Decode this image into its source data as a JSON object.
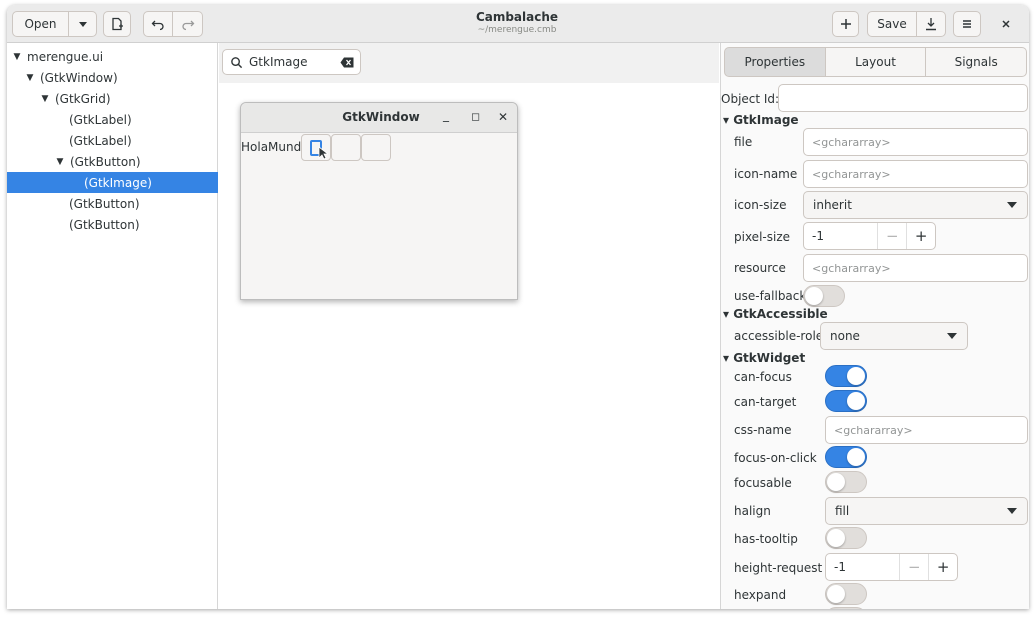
{
  "header": {
    "open_label": "Open",
    "save_label": "Save",
    "title": "Cambalache",
    "subtitle": "~/merengue.cmb"
  },
  "tree": {
    "items": [
      {
        "label": "merengue.ui",
        "expander": "▼"
      },
      {
        "label": "(GtkWindow)",
        "expander": "▼"
      },
      {
        "label": "(GtkGrid)",
        "expander": "▼"
      },
      {
        "label": "(GtkLabel)",
        "expander": ""
      },
      {
        "label": "(GtkLabel)",
        "expander": ""
      },
      {
        "label": "(GtkButton)",
        "expander": "▼"
      },
      {
        "label": "(GtkImage)",
        "expander": "",
        "selected": true
      },
      {
        "label": "(GtkButton)",
        "expander": ""
      },
      {
        "label": "(GtkButton)",
        "expander": ""
      }
    ]
  },
  "search": {
    "value": "GtkImage"
  },
  "preview": {
    "title": "GtkWindow",
    "label": "HolaMundo",
    "minimize": "_",
    "maximize": "◻",
    "close": "✕"
  },
  "properties": {
    "tabs": [
      "Properties",
      "Layout",
      "Signals"
    ],
    "object_id_label": "Object Id:",
    "sections": {
      "image": "GtkImage",
      "accessible": "GtkAccessible",
      "widget": "GtkWidget"
    },
    "placeholder": "<gchararray>",
    "rows": {
      "file": "file",
      "icon_name": "icon-name",
      "icon_size": "icon-size",
      "icon_size_value": "inherit",
      "pixel_size": "pixel-size",
      "pixel_size_value": "-1",
      "resource": "resource",
      "use_fallback": "use-fallback",
      "accessible_role": "accessible-role",
      "accessible_role_value": "none",
      "can_focus": "can-focus",
      "can_target": "can-target",
      "css_name": "css-name",
      "focus_on_click": "focus-on-click",
      "focusable": "focusable",
      "halign": "halign",
      "halign_value": "fill",
      "has_tooltip": "has-tooltip",
      "height_request": "height-request",
      "height_request_value": "-1",
      "hexpand": "hexpand"
    },
    "switches": {
      "use_fallback": false,
      "can_focus": true,
      "can_target": true,
      "focus_on_click": true,
      "focusable": false,
      "has_tooltip": false,
      "hexpand": false
    },
    "spin_minus": "−",
    "spin_plus": "+"
  },
  "colors": {
    "accent": "#3584e4",
    "header_bg": "#ebebeb"
  }
}
